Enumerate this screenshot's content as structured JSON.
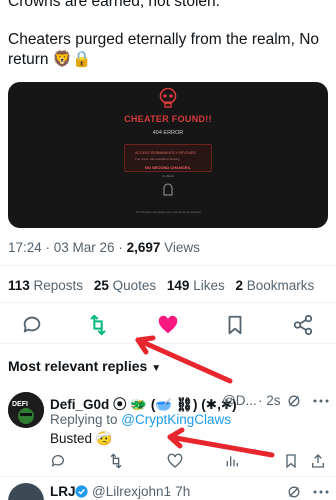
{
  "tweet": {
    "line0": "Crowns are earned, not stolen.",
    "line1": "Cheaters purged eternally from the realm, No",
    "line2": "return 🦁🔒"
  },
  "media": {
    "title": "CHEATER FOUND!!",
    "subtitle": "404 ERROR",
    "notice_line1": "ACCESS PERMANENTLY REVOKED",
    "notice_line2": "The crown has identified cheating",
    "notice_line3": "NO SECOND CHANCES.",
    "goback": "Go Back",
    "footer": "This kingdom has judged you and found you wanting"
  },
  "meta": {
    "time": "17:24 · 03 Mar 26 · ",
    "views_count": "2,697",
    "views_label": " Views"
  },
  "stats": {
    "reposts_count": "113",
    "reposts_label": " Reposts",
    "quotes_count": "25",
    "quotes_label": " Quotes",
    "likes_count": "149",
    "likes_label": " Likes",
    "bookmarks_count": "2",
    "bookmarks_label": " Bookmarks"
  },
  "colors": {
    "repost_active": "#00ba7c",
    "like_active": "#f91880",
    "icon_gray": "#536471",
    "arrow_red": "#e8262d",
    "link_blue": "#1d9bf0"
  },
  "replies": {
    "header": "Most relevant replies",
    "items": [
      {
        "name": "Defi_G0d ⦿ 🐲 (🥣 ⛓) (✱,✱)",
        "handle": "@D...",
        "time": "· 2s",
        "replying_label": "Replying to ",
        "replying_to": "@CryptKingClaws",
        "body": "Busted 🤕"
      },
      {
        "name": "LRJ",
        "handle": "@Lilrexjohn1",
        "time": "· 7h"
      }
    ]
  }
}
